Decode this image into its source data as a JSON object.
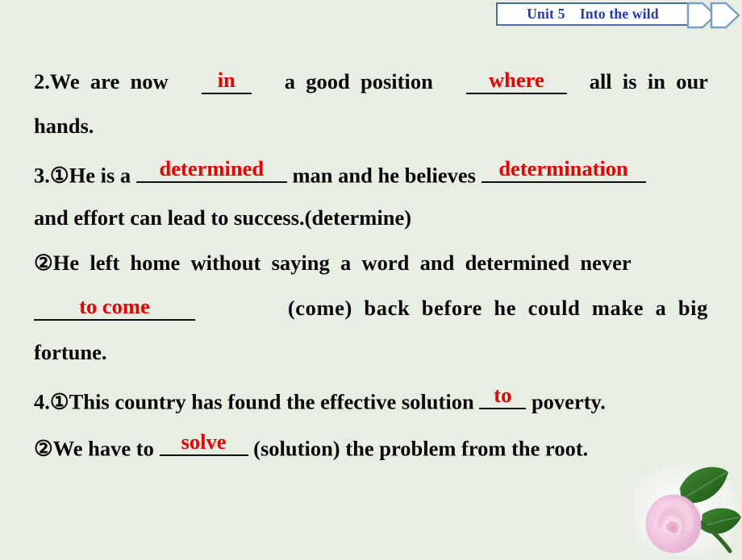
{
  "header": {
    "unit_label": "Unit 5",
    "unit_title": "Into the wild",
    "banner_text": "Unit 5    Into the wild",
    "accent_color": "#1f36c8",
    "border_color": "#4472a8",
    "chevron_icon": "double-chevron-right-icon"
  },
  "page": {
    "background_color": "#e9eee4",
    "answer_color": "#ee0000",
    "text_color": "#0a0a0a"
  },
  "exercises": [
    {
      "number": "2.",
      "line1_before": "2.We  are  now  ",
      "blank1_answer": "in",
      "line1_mid": "  a  good  position  ",
      "blank2_answer": "where",
      "line1_after": "all  is  in  our",
      "line2": "hands."
    },
    {
      "number": "3.",
      "marker1": "①",
      "l1_a": "3.①He is a ",
      "blank1_answer": "determined",
      "l1_b": " man and he believes ",
      "blank2_answer": "determination",
      "l2": "and effort can lead to success.(determine)",
      "marker2": "②",
      "l3": "②He  left  home  without  saying  a  word  and  determined  never",
      "blank3_answer": "to come",
      "l4_after": "(come)  back  before  he  could  make  a  big",
      "l5": "fortune."
    },
    {
      "number": "4.",
      "marker1": "①",
      "l1_a": "4.①This country has found the effective solution ",
      "blank1_answer": "to",
      "l1_b": " poverty.",
      "marker2": "②",
      "l2_a": "②We have to ",
      "blank2_answer": "solve",
      "l2_b": " (solution) the problem from the root."
    }
  ],
  "decoration": {
    "rose_icon": "pink-rose-flower-image",
    "petal_color": "#e8b6d2",
    "leaf_color": "#2f6b24"
  }
}
